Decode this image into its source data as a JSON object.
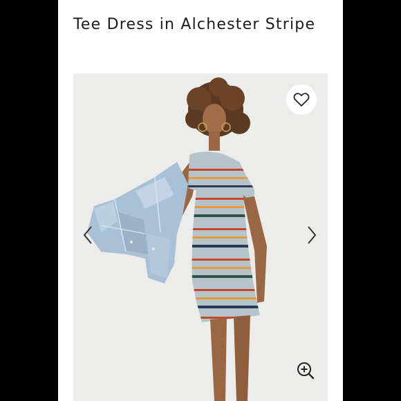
{
  "product": {
    "title": "Tee Dress in Alchester Stripe"
  },
  "icons": {
    "favorite": "heart-icon",
    "previous": "chevron-left-icon",
    "next": "chevron-right-icon",
    "zoom": "zoom-in-icon"
  },
  "colors": {
    "page_background": "#000000",
    "card_background": "#ffffff",
    "photo_background": "#ececea",
    "stripe_red": "#c8452e",
    "stripe_orange": "#e69a3c",
    "stripe_green": "#2f5447",
    "stripe_navy": "#2d3a55",
    "dress_base": "#b5c4c8"
  }
}
